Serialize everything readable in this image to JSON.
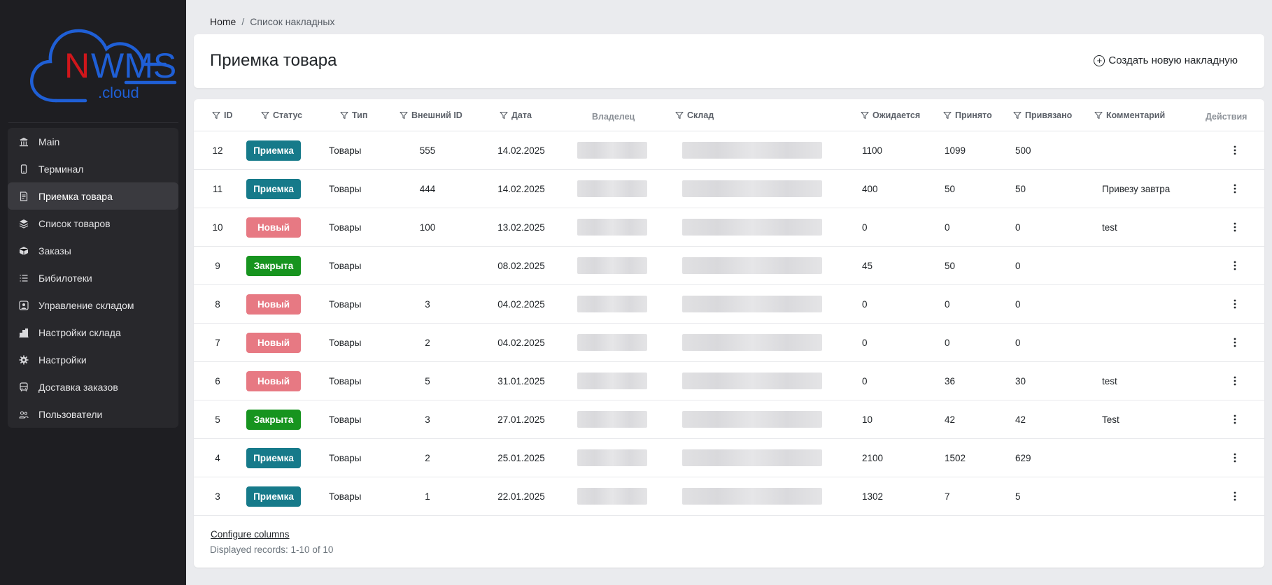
{
  "brand": {
    "name_first": "N",
    "name_rest": "WMS",
    "suffix": ".cloud",
    "color_red": "#d0161b",
    "color_blue": "#1f5fd6"
  },
  "sidebar": {
    "items": [
      {
        "label": "Main",
        "icon": "bank-icon",
        "active": false
      },
      {
        "label": "Терминал",
        "icon": "phone-icon",
        "active": false
      },
      {
        "label": "Приемка товара",
        "icon": "receipt-icon",
        "active": true
      },
      {
        "label": "Список товаров",
        "icon": "layers-icon",
        "active": false
      },
      {
        "label": "Заказы",
        "icon": "box-icon",
        "active": false
      },
      {
        "label": "Бибилотеки",
        "icon": "list-icon",
        "active": false
      },
      {
        "label": "Управление складом",
        "icon": "person-square-icon",
        "active": false
      },
      {
        "label": "Настройки склада",
        "icon": "buildings-icon",
        "active": false
      },
      {
        "label": "Настройки",
        "icon": "gear-icon",
        "active": false
      },
      {
        "label": "Доставка заказов",
        "icon": "bus-icon",
        "active": false
      },
      {
        "label": "Пользователи",
        "icon": "people-icon",
        "active": false
      }
    ]
  },
  "breadcrumb": {
    "home": "Home",
    "separator": "/",
    "current": "Список накладных"
  },
  "header": {
    "title": "Приемка товара",
    "create_label": "Создать новую накладную"
  },
  "table": {
    "columns": {
      "id": "ID",
      "status": "Статус",
      "type": "Тип",
      "external_id": "Внешний ID",
      "date": "Дата",
      "owner": "Владелец",
      "warehouse": "Склад",
      "expected": "Ожидается",
      "received": "Принято",
      "linked": "Привязано",
      "comment": "Комментарий",
      "actions": "Действия"
    },
    "rows": [
      {
        "id": "12",
        "status": "Приемка",
        "status_kind": "priemka",
        "type": "Товары",
        "external_id": "555",
        "date": "14.02.2025",
        "expected": "1100",
        "received": "1099",
        "linked": "500",
        "comment": ""
      },
      {
        "id": "11",
        "status": "Приемка",
        "status_kind": "priemka",
        "type": "Товары",
        "external_id": "444",
        "date": "14.02.2025",
        "expected": "400",
        "received": "50",
        "linked": "50",
        "comment": "Привезу завтра"
      },
      {
        "id": "10",
        "status": "Новый",
        "status_kind": "new",
        "type": "Товары",
        "external_id": "100",
        "date": "13.02.2025",
        "expected": "0",
        "received": "0",
        "linked": "0",
        "comment": "test"
      },
      {
        "id": "9",
        "status": "Закрыта",
        "status_kind": "closed",
        "type": "Товары",
        "external_id": "",
        "date": "08.02.2025",
        "expected": "45",
        "received": "50",
        "linked": "0",
        "comment": ""
      },
      {
        "id": "8",
        "status": "Новый",
        "status_kind": "new",
        "type": "Товары",
        "external_id": "3",
        "date": "04.02.2025",
        "expected": "0",
        "received": "0",
        "linked": "0",
        "comment": ""
      },
      {
        "id": "7",
        "status": "Новый",
        "status_kind": "new",
        "type": "Товары",
        "external_id": "2",
        "date": "04.02.2025",
        "expected": "0",
        "received": "0",
        "linked": "0",
        "comment": ""
      },
      {
        "id": "6",
        "status": "Новый",
        "status_kind": "new",
        "type": "Товары",
        "external_id": "5",
        "date": "31.01.2025",
        "expected": "0",
        "received": "36",
        "linked": "30",
        "comment": "test"
      },
      {
        "id": "5",
        "status": "Закрыта",
        "status_kind": "closed",
        "type": "Товары",
        "external_id": "3",
        "date": "27.01.2025",
        "expected": "10",
        "received": "42",
        "linked": "42",
        "comment": "Test"
      },
      {
        "id": "4",
        "status": "Приемка",
        "status_kind": "priemka",
        "type": "Товары",
        "external_id": "2",
        "date": "25.01.2025",
        "expected": "2100",
        "received": "1502",
        "linked": "629",
        "comment": ""
      },
      {
        "id": "3",
        "status": "Приемка",
        "status_kind": "priemka",
        "type": "Товары",
        "external_id": "1",
        "date": "22.01.2025",
        "expected": "1302",
        "received": "7",
        "linked": "5",
        "comment": ""
      }
    ]
  },
  "footer": {
    "configure_label": "Configure columns",
    "records_label": "Displayed records: 1-10 of 10"
  },
  "colors": {
    "priemka": "#167a8a",
    "new": "#e77983",
    "closed": "#17941f",
    "sidebar_bg": "#1e1e22"
  }
}
